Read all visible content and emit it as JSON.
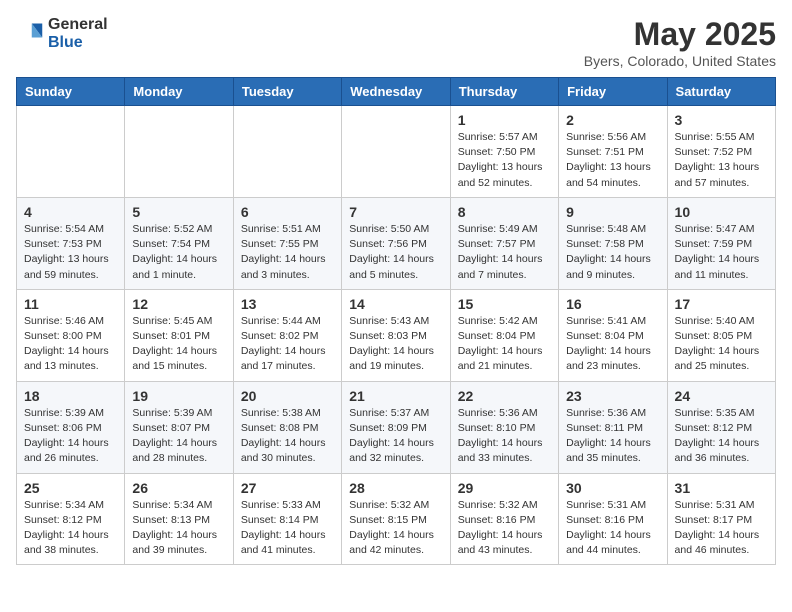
{
  "header": {
    "logo_general": "General",
    "logo_blue": "Blue",
    "month_title": "May 2025",
    "location": "Byers, Colorado, United States"
  },
  "weekdays": [
    "Sunday",
    "Monday",
    "Tuesday",
    "Wednesday",
    "Thursday",
    "Friday",
    "Saturday"
  ],
  "weeks": [
    [
      {
        "day": "",
        "info": ""
      },
      {
        "day": "",
        "info": ""
      },
      {
        "day": "",
        "info": ""
      },
      {
        "day": "",
        "info": ""
      },
      {
        "day": "1",
        "info": "Sunrise: 5:57 AM\nSunset: 7:50 PM\nDaylight: 13 hours\nand 52 minutes."
      },
      {
        "day": "2",
        "info": "Sunrise: 5:56 AM\nSunset: 7:51 PM\nDaylight: 13 hours\nand 54 minutes."
      },
      {
        "day": "3",
        "info": "Sunrise: 5:55 AM\nSunset: 7:52 PM\nDaylight: 13 hours\nand 57 minutes."
      }
    ],
    [
      {
        "day": "4",
        "info": "Sunrise: 5:54 AM\nSunset: 7:53 PM\nDaylight: 13 hours\nand 59 minutes."
      },
      {
        "day": "5",
        "info": "Sunrise: 5:52 AM\nSunset: 7:54 PM\nDaylight: 14 hours\nand 1 minute."
      },
      {
        "day": "6",
        "info": "Sunrise: 5:51 AM\nSunset: 7:55 PM\nDaylight: 14 hours\nand 3 minutes."
      },
      {
        "day": "7",
        "info": "Sunrise: 5:50 AM\nSunset: 7:56 PM\nDaylight: 14 hours\nand 5 minutes."
      },
      {
        "day": "8",
        "info": "Sunrise: 5:49 AM\nSunset: 7:57 PM\nDaylight: 14 hours\nand 7 minutes."
      },
      {
        "day": "9",
        "info": "Sunrise: 5:48 AM\nSunset: 7:58 PM\nDaylight: 14 hours\nand 9 minutes."
      },
      {
        "day": "10",
        "info": "Sunrise: 5:47 AM\nSunset: 7:59 PM\nDaylight: 14 hours\nand 11 minutes."
      }
    ],
    [
      {
        "day": "11",
        "info": "Sunrise: 5:46 AM\nSunset: 8:00 PM\nDaylight: 14 hours\nand 13 minutes."
      },
      {
        "day": "12",
        "info": "Sunrise: 5:45 AM\nSunset: 8:01 PM\nDaylight: 14 hours\nand 15 minutes."
      },
      {
        "day": "13",
        "info": "Sunrise: 5:44 AM\nSunset: 8:02 PM\nDaylight: 14 hours\nand 17 minutes."
      },
      {
        "day": "14",
        "info": "Sunrise: 5:43 AM\nSunset: 8:03 PM\nDaylight: 14 hours\nand 19 minutes."
      },
      {
        "day": "15",
        "info": "Sunrise: 5:42 AM\nSunset: 8:04 PM\nDaylight: 14 hours\nand 21 minutes."
      },
      {
        "day": "16",
        "info": "Sunrise: 5:41 AM\nSunset: 8:04 PM\nDaylight: 14 hours\nand 23 minutes."
      },
      {
        "day": "17",
        "info": "Sunrise: 5:40 AM\nSunset: 8:05 PM\nDaylight: 14 hours\nand 25 minutes."
      }
    ],
    [
      {
        "day": "18",
        "info": "Sunrise: 5:39 AM\nSunset: 8:06 PM\nDaylight: 14 hours\nand 26 minutes."
      },
      {
        "day": "19",
        "info": "Sunrise: 5:39 AM\nSunset: 8:07 PM\nDaylight: 14 hours\nand 28 minutes."
      },
      {
        "day": "20",
        "info": "Sunrise: 5:38 AM\nSunset: 8:08 PM\nDaylight: 14 hours\nand 30 minutes."
      },
      {
        "day": "21",
        "info": "Sunrise: 5:37 AM\nSunset: 8:09 PM\nDaylight: 14 hours\nand 32 minutes."
      },
      {
        "day": "22",
        "info": "Sunrise: 5:36 AM\nSunset: 8:10 PM\nDaylight: 14 hours\nand 33 minutes."
      },
      {
        "day": "23",
        "info": "Sunrise: 5:36 AM\nSunset: 8:11 PM\nDaylight: 14 hours\nand 35 minutes."
      },
      {
        "day": "24",
        "info": "Sunrise: 5:35 AM\nSunset: 8:12 PM\nDaylight: 14 hours\nand 36 minutes."
      }
    ],
    [
      {
        "day": "25",
        "info": "Sunrise: 5:34 AM\nSunset: 8:12 PM\nDaylight: 14 hours\nand 38 minutes."
      },
      {
        "day": "26",
        "info": "Sunrise: 5:34 AM\nSunset: 8:13 PM\nDaylight: 14 hours\nand 39 minutes."
      },
      {
        "day": "27",
        "info": "Sunrise: 5:33 AM\nSunset: 8:14 PM\nDaylight: 14 hours\nand 41 minutes."
      },
      {
        "day": "28",
        "info": "Sunrise: 5:32 AM\nSunset: 8:15 PM\nDaylight: 14 hours\nand 42 minutes."
      },
      {
        "day": "29",
        "info": "Sunrise: 5:32 AM\nSunset: 8:16 PM\nDaylight: 14 hours\nand 43 minutes."
      },
      {
        "day": "30",
        "info": "Sunrise: 5:31 AM\nSunset: 8:16 PM\nDaylight: 14 hours\nand 44 minutes."
      },
      {
        "day": "31",
        "info": "Sunrise: 5:31 AM\nSunset: 8:17 PM\nDaylight: 14 hours\nand 46 minutes."
      }
    ]
  ]
}
